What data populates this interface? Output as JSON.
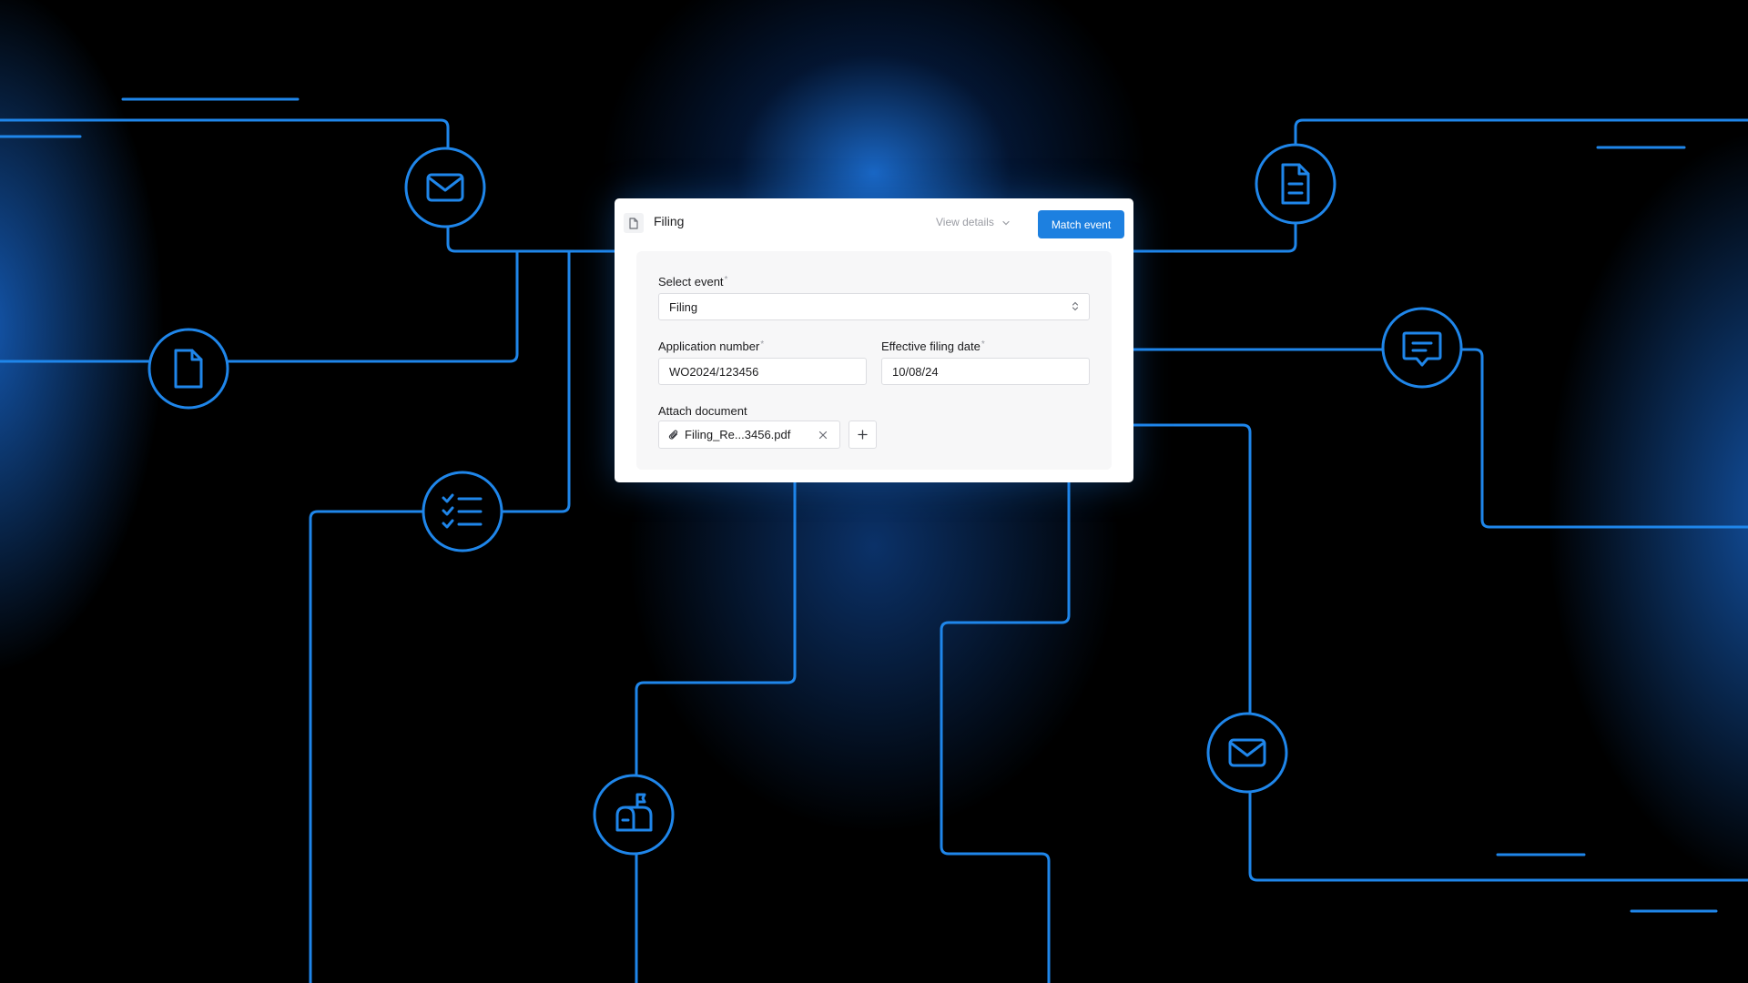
{
  "dialog": {
    "title": "Filing",
    "view_details_label": "View details",
    "match_button_label": "Match event",
    "select_event": {
      "label": "Select event",
      "required_mark": "*",
      "value": "Filing"
    },
    "application_number": {
      "label": "Application number",
      "required_mark": "*",
      "value": "WO2024/123456"
    },
    "effective_filing_date": {
      "label": "Effective filing date",
      "required_mark": "*",
      "value": "10/08/24"
    },
    "attach_document": {
      "label": "Attach document",
      "file_name": "Filing_Re...3456.pdf"
    }
  },
  "icons": {
    "header": "document-icon",
    "view_details": "chevron-down-icon",
    "select": "up-down-chevron-icon",
    "attachment": "paperclip-icon",
    "remove": "close-icon",
    "add": "plus-icon",
    "nodes": [
      "envelope-icon",
      "document-icon",
      "checklist-icon",
      "mailbox-icon",
      "document-lines-icon",
      "chat-icon",
      "envelope-icon"
    ]
  },
  "colors": {
    "accent": "#1d80e0",
    "circuit": "#1f86ea",
    "background": "#000000"
  }
}
